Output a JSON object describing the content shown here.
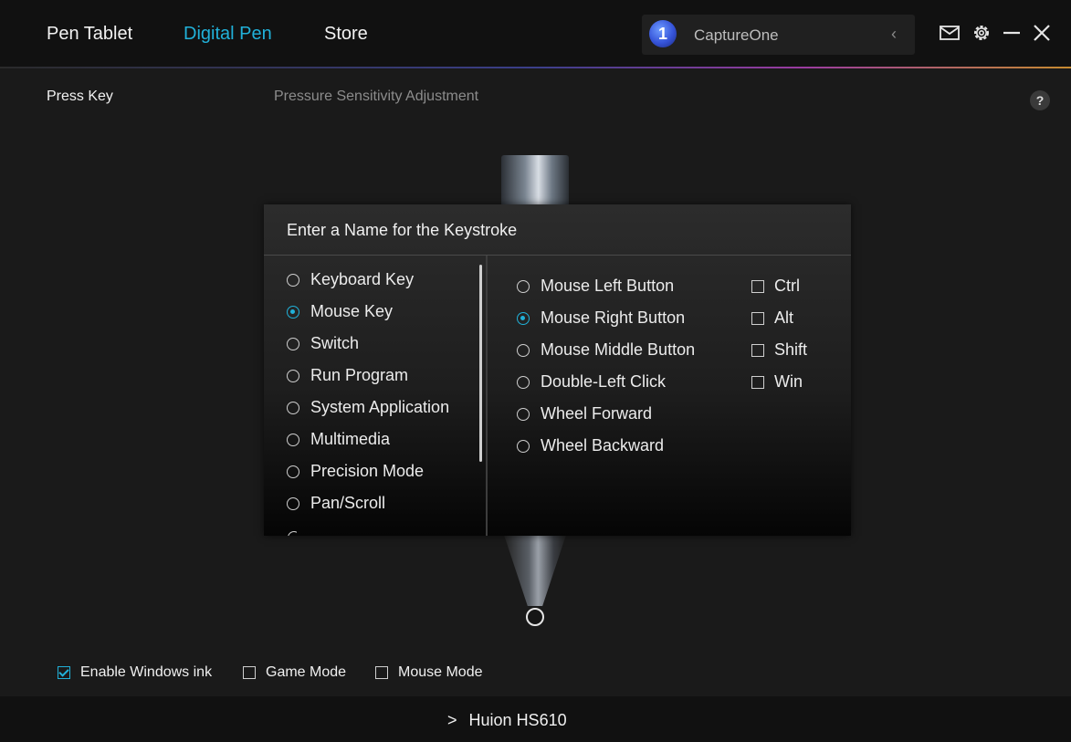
{
  "header": {
    "tabs": [
      {
        "label": "Pen Tablet",
        "active": false
      },
      {
        "label": "Digital Pen",
        "active": true
      },
      {
        "label": "Store",
        "active": false
      }
    ],
    "app_selector": {
      "logo_text": "1",
      "name": "CaptureOne"
    },
    "icons": [
      "mail-icon",
      "gear-icon",
      "minimize-icon",
      "close-icon"
    ]
  },
  "subtabs": {
    "press_key": "Press Key",
    "pressure": "Pressure Sensitivity Adjustment",
    "help": "?"
  },
  "dialog": {
    "title": "Enter a Name for the Keystroke",
    "categories": [
      {
        "label": "Keyboard Key",
        "selected": false
      },
      {
        "label": "Mouse Key",
        "selected": true
      },
      {
        "label": "Switch",
        "selected": false
      },
      {
        "label": "Run Program",
        "selected": false
      },
      {
        "label": "System Application",
        "selected": false
      },
      {
        "label": "Multimedia",
        "selected": false
      },
      {
        "label": "Precision Mode",
        "selected": false
      },
      {
        "label": "Pan/Scroll",
        "selected": false
      }
    ],
    "mouse_options": [
      {
        "label": "Mouse Left Button",
        "selected": false
      },
      {
        "label": "Mouse Right Button",
        "selected": true
      },
      {
        "label": "Mouse Middle Button",
        "selected": false
      },
      {
        "label": "Double-Left Click",
        "selected": false
      },
      {
        "label": "Wheel Forward",
        "selected": false
      },
      {
        "label": "Wheel Backward",
        "selected": false
      }
    ],
    "modifiers": [
      {
        "label": "Ctrl",
        "checked": false
      },
      {
        "label": "Alt",
        "checked": false
      },
      {
        "label": "Shift",
        "checked": false
      },
      {
        "label": "Win",
        "checked": false
      }
    ]
  },
  "options": [
    {
      "label": "Enable Windows ink",
      "checked": true
    },
    {
      "label": "Game Mode",
      "checked": false
    },
    {
      "label": "Mouse Mode",
      "checked": false
    }
  ],
  "footer": {
    "chevron": ">",
    "device": "Huion HS610"
  },
  "colors": {
    "accent": "#21b1d9",
    "background": "#1a1a1a",
    "bar": "#111111"
  }
}
